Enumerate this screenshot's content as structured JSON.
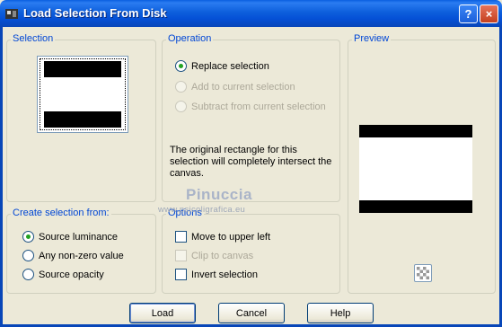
{
  "window": {
    "title": "Load Selection From Disk",
    "help_glyph": "?",
    "close_glyph": "×"
  },
  "selection": {
    "title": "Selection"
  },
  "operation": {
    "title": "Operation",
    "options": [
      {
        "label": "Replace selection",
        "checked": true,
        "enabled": true
      },
      {
        "label": "Add to current selection",
        "checked": false,
        "enabled": false
      },
      {
        "label": "Subtract from current selection",
        "checked": false,
        "enabled": false
      }
    ],
    "info": "The original rectangle for this selection will completely intersect the canvas."
  },
  "preview": {
    "title": "Preview"
  },
  "create_from": {
    "title": "Create selection from:",
    "options": [
      {
        "label": "Source luminance",
        "checked": true
      },
      {
        "label": "Any non-zero value",
        "checked": false
      },
      {
        "label": "Source opacity",
        "checked": false
      }
    ]
  },
  "options": {
    "title": "Options",
    "items": [
      {
        "label": "Move to upper left",
        "checked": false,
        "enabled": true
      },
      {
        "label": "Clip to canvas",
        "checked": false,
        "enabled": false
      },
      {
        "label": "Invert selection",
        "checked": false,
        "enabled": true
      }
    ]
  },
  "buttons": {
    "load": "Load",
    "cancel": "Cancel",
    "help": "Help"
  },
  "watermark": {
    "name": "Pinuccia",
    "url": "www.psicoligrafica.eu"
  },
  "colors": {
    "titlebar": "#0a5ee0",
    "group_title": "#0046d5",
    "dialog_bg": "#ece9d8"
  }
}
